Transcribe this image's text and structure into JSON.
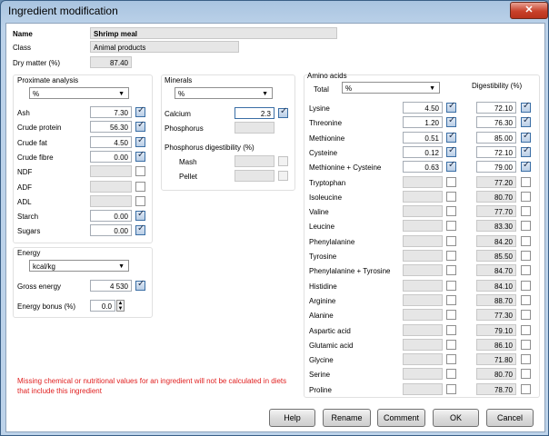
{
  "window": {
    "title": "Ingredient modification",
    "close_glyph": "✕"
  },
  "header": {
    "name_label": "Name",
    "name_value": "Shrimp meal",
    "class_label": "Class",
    "class_value": "Animal products",
    "dm_label": "Dry matter (%)",
    "dm_value": "87.40"
  },
  "proximate": {
    "title": "Proximate analysis",
    "unit": "%",
    "rows": [
      {
        "label": "Ash",
        "value": "7.30",
        "checked": true,
        "enabled": true
      },
      {
        "label": "Crude protein",
        "value": "56.30",
        "checked": true,
        "enabled": true
      },
      {
        "label": "Crude fat",
        "value": "4.50",
        "checked": true,
        "enabled": true
      },
      {
        "label": "Crude fibre",
        "value": "0.00",
        "checked": true,
        "enabled": true
      },
      {
        "label": "NDF",
        "value": "",
        "checked": false,
        "enabled": false
      },
      {
        "label": "ADF",
        "value": "",
        "checked": false,
        "enabled": false
      },
      {
        "label": "ADL",
        "value": "",
        "checked": false,
        "enabled": false
      },
      {
        "label": "Starch",
        "value": "0.00",
        "checked": true,
        "enabled": true
      },
      {
        "label": "Sugars",
        "value": "0.00",
        "checked": true,
        "enabled": true
      }
    ]
  },
  "energy": {
    "title": "Energy",
    "unit": "kcal/kg",
    "gross_label": "Gross energy",
    "gross_value": "4 530",
    "bonus_label": "Energy bonus (%)",
    "bonus_value": "0.0"
  },
  "minerals": {
    "title": "Minerals",
    "unit": "%",
    "calcium_label": "Calcium",
    "calcium_value": "2.3",
    "phosphorus_label": "Phosphorus",
    "pdig_title": "Phosphorus digestibility (%)",
    "mash_label": "Mash",
    "pellet_label": "Pellet"
  },
  "amino": {
    "title": "Amino acids",
    "total_label": "Total",
    "unit": "%",
    "dig_title": "Digestibility (%)",
    "rows": [
      {
        "label": "Lysine",
        "value": "4.50",
        "checked": true,
        "dig": "72.10",
        "dig_checked": true
      },
      {
        "label": "Threonine",
        "value": "1.20",
        "checked": true,
        "dig": "76.30",
        "dig_checked": true
      },
      {
        "label": "Methionine",
        "value": "0.51",
        "checked": true,
        "dig": "85.00",
        "dig_checked": true
      },
      {
        "label": "Cysteine",
        "value": "0.12",
        "checked": true,
        "dig": "72.10",
        "dig_checked": true
      },
      {
        "label": "Methionine + Cysteine",
        "value": "0.63",
        "checked": true,
        "dig": "79.00",
        "dig_checked": true
      },
      {
        "label": "Tryptophan",
        "value": "",
        "checked": false,
        "dig": "77.20",
        "dig_checked": false
      },
      {
        "label": "Isoleucine",
        "value": "",
        "checked": false,
        "dig": "80.70",
        "dig_checked": false
      },
      {
        "label": "Valine",
        "value": "",
        "checked": false,
        "dig": "77.70",
        "dig_checked": false
      },
      {
        "label": "Leucine",
        "value": "",
        "checked": false,
        "dig": "83.30",
        "dig_checked": false
      },
      {
        "label": "Phenylalanine",
        "value": "",
        "checked": false,
        "dig": "84.20",
        "dig_checked": false
      },
      {
        "label": "Tyrosine",
        "value": "",
        "checked": false,
        "dig": "85.50",
        "dig_checked": false
      },
      {
        "label": "Phenylalanine + Tyrosine",
        "value": "",
        "checked": false,
        "dig": "84.70",
        "dig_checked": false
      },
      {
        "label": "Histidine",
        "value": "",
        "checked": false,
        "dig": "84.10",
        "dig_checked": false
      },
      {
        "label": "Arginine",
        "value": "",
        "checked": false,
        "dig": "88.70",
        "dig_checked": false
      },
      {
        "label": "Alanine",
        "value": "",
        "checked": false,
        "dig": "77.30",
        "dig_checked": false
      },
      {
        "label": "Aspartic acid",
        "value": "",
        "checked": false,
        "dig": "79.10",
        "dig_checked": false
      },
      {
        "label": "Glutamic acid",
        "value": "",
        "checked": false,
        "dig": "86.10",
        "dig_checked": false
      },
      {
        "label": "Glycine",
        "value": "",
        "checked": false,
        "dig": "71.80",
        "dig_checked": false
      },
      {
        "label": "Serine",
        "value": "",
        "checked": false,
        "dig": "80.70",
        "dig_checked": false
      },
      {
        "label": "Proline",
        "value": "",
        "checked": false,
        "dig": "78.70",
        "dig_checked": false
      }
    ]
  },
  "warning": "Missing chemical or nutritional values for an ingredient will not be calculated in diets that include this ingredient",
  "buttons": {
    "help": "Help",
    "rename": "Rename",
    "comment": "Comment",
    "ok": "OK",
    "cancel": "Cancel"
  },
  "colors": {
    "warning": "#e02020",
    "title_bar": "#a9c4e0",
    "close_button": "#c8412a"
  }
}
